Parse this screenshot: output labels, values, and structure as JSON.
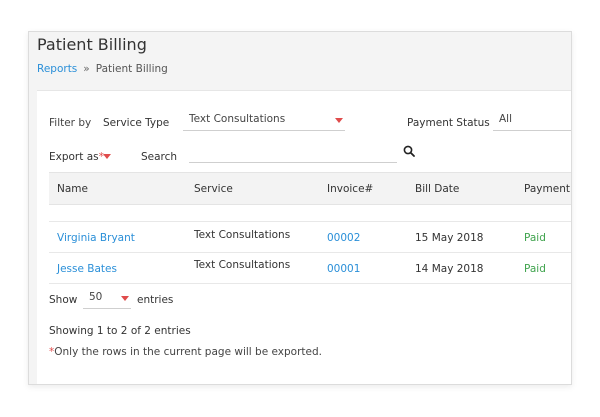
{
  "page": {
    "title": "Patient Billing"
  },
  "breadcrumb": {
    "parent": "Reports",
    "separator": "»",
    "current": "Patient Billing"
  },
  "filters": {
    "filter_by_label": "Filter by",
    "service_type_label": "Service Type",
    "service_type_value": "Text Consultations",
    "payment_status_label": "Payment Status",
    "payment_status_value": "All",
    "export_label": "Export as",
    "export_asterisk": "*",
    "search_label": "Search",
    "search_value": ""
  },
  "table": {
    "columns": [
      "Name",
      "Service",
      "Invoice#",
      "Bill Date",
      "Payment"
    ],
    "rows": [
      {
        "name": "Virginia Bryant",
        "service": "Text Consultations",
        "invoice": "00002",
        "bill_date": "15 May 2018",
        "payment": "Paid"
      },
      {
        "name": "Jesse Bates",
        "service": "Text Consultations",
        "invoice": "00001",
        "bill_date": "14 May 2018",
        "payment": "Paid"
      }
    ]
  },
  "pagination": {
    "show_label": "Show",
    "page_size": "50",
    "entries_label": "entries",
    "summary": "Showing 1 to 2 of 2 entries"
  },
  "note": {
    "asterisk": "*",
    "text": "Only the rows in the current page will be exported."
  },
  "colors": {
    "link": "#2a8fd8",
    "paid": "#3fa34d",
    "required": "#e04b4b"
  },
  "icons": {
    "search": "search-icon",
    "dropdown": "caret-down-icon"
  }
}
